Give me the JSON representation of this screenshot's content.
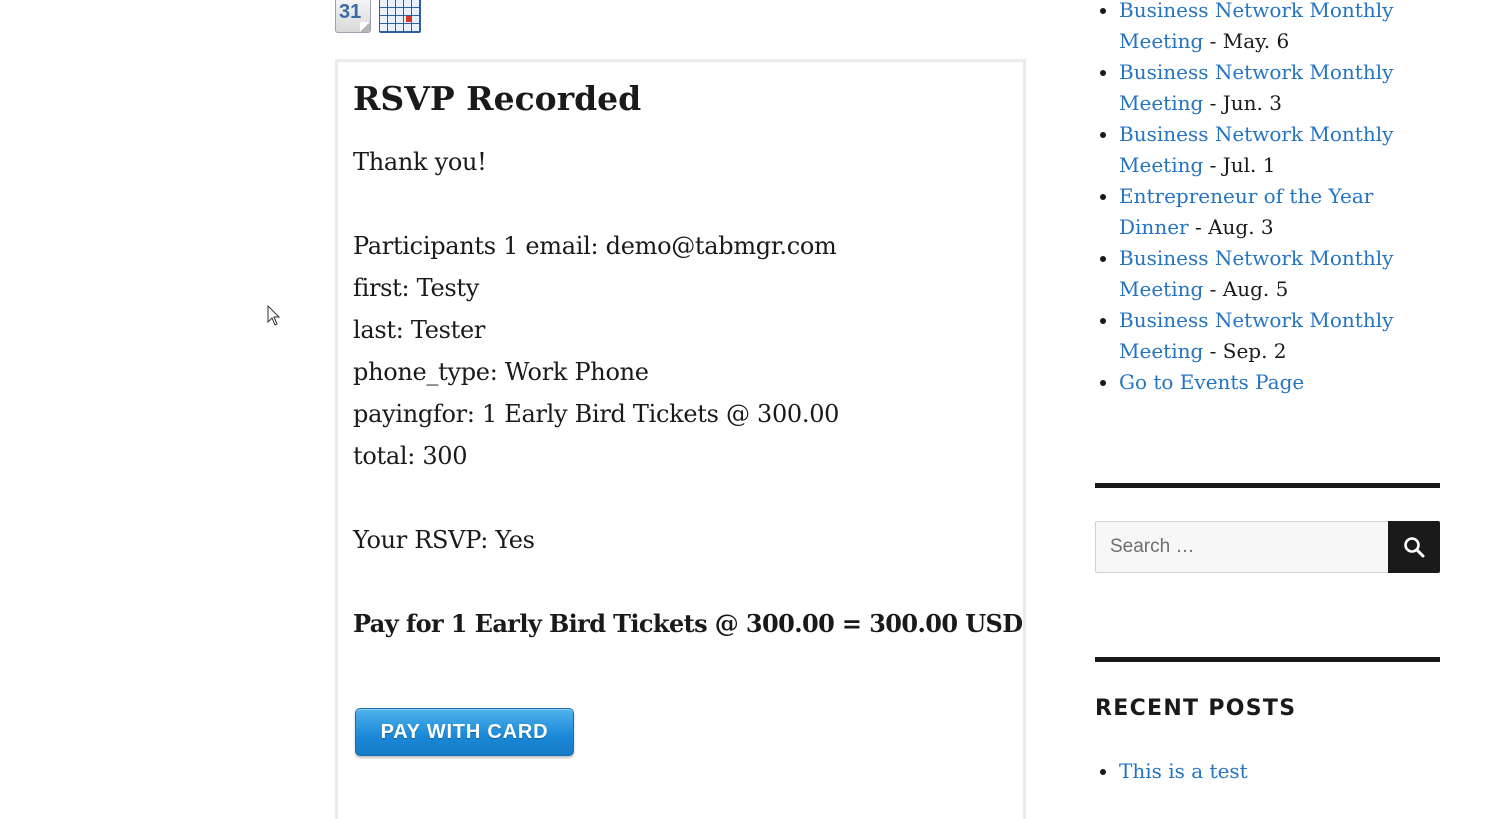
{
  "calendar_icons": {
    "ical_day": "31"
  },
  "rsvp": {
    "title": "RSVP Recorded",
    "thank_you": "Thank you!",
    "participant_email": "Participants 1 email: demo@tabmgr.com",
    "first": "first: Testy",
    "last": "last: Tester",
    "phone_type": "phone_type: Work Phone",
    "payingfor": "payingfor: 1 Early Bird Tickets @ 300.00",
    "total": "total: 300",
    "your_rsvp": "Your RSVP: Yes",
    "pay_summary": "Pay for 1 Early Bird Tickets @ 300.00 = 300.00 USD",
    "pay_button_label": "PAY WITH CARD"
  },
  "sidebar": {
    "events": [
      {
        "title": "Business Network Monthly Meeting",
        "date": " - May. 6"
      },
      {
        "title": "Business Network Monthly Meeting",
        "date": " - Jun. 3"
      },
      {
        "title": "Business Network Monthly Meeting",
        "date": " - Jul. 1"
      },
      {
        "title": "Entrepreneur of the Year Dinner",
        "date": " - Aug. 3"
      },
      {
        "title": "Business Network Monthly Meeting",
        "date": " - Aug. 5"
      },
      {
        "title": "Business Network Monthly Meeting",
        "date": " - Sep. 2"
      }
    ],
    "events_page_link": "Go to Events Page",
    "search_placeholder": "Search …",
    "recent_posts_title": "RECENT POSTS",
    "recent_posts": [
      "This is a test"
    ]
  },
  "colors": {
    "link": "#2474c2",
    "text": "#1a1a1a",
    "pay_button": "#1a88d6",
    "search_button": "#1a1a1a"
  }
}
